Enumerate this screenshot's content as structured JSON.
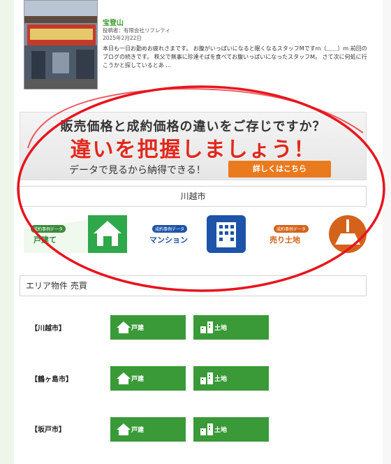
{
  "post": {
    "title": "宝登山",
    "author": "投稿者：有限会社リフレティ",
    "date": "2025年2月22日",
    "body": "本日も一日お勤めお疲れさまです。 お腹がいっぱいになると眠くなるスタッフMですm（＿＿）m 前回のブログの続きです。 秩父で無事に珍達そばを食べてお腹いっぱいになったスタッフM。 さて次に何処に行こうかと探しているとあ …"
  },
  "banner": {
    "line1": "販売価格と成約価格の違いをご存じですか？",
    "line2": "違いを把握しましょう！",
    "line3": "データで見るから納得できる！",
    "cta": "詳しくはこちら"
  },
  "city_bar": {
    "label": "川越市"
  },
  "categories": [
    {
      "tag": "成約事例データ",
      "name": "戸建て",
      "color": "#2ea84a",
      "tagcolor": "#3a8a3a"
    },
    {
      "tag": "成約事例データ",
      "name": "マンション",
      "color": "#1d53a8",
      "tagcolor": "#1d53a8"
    },
    {
      "tag": "成約事例データ",
      "name": "売り土地",
      "color": "#d4621a",
      "tagcolor": "#d4621a"
    }
  ],
  "area": {
    "title": "エリア物件 売買",
    "rows": [
      {
        "label": "【川越市】",
        "house": "戸建",
        "land": "土地"
      },
      {
        "label": "【鶴ヶ島市】",
        "house": "戸建",
        "land": "土地"
      },
      {
        "label": "【坂戸市】",
        "house": "戸建",
        "land": "土地"
      }
    ]
  },
  "colors": {
    "accent_green": "#3a9a38",
    "cta_orange": "#ea7a1e",
    "headline_red": "#e0281c",
    "annotation_red": "#e8141c"
  }
}
